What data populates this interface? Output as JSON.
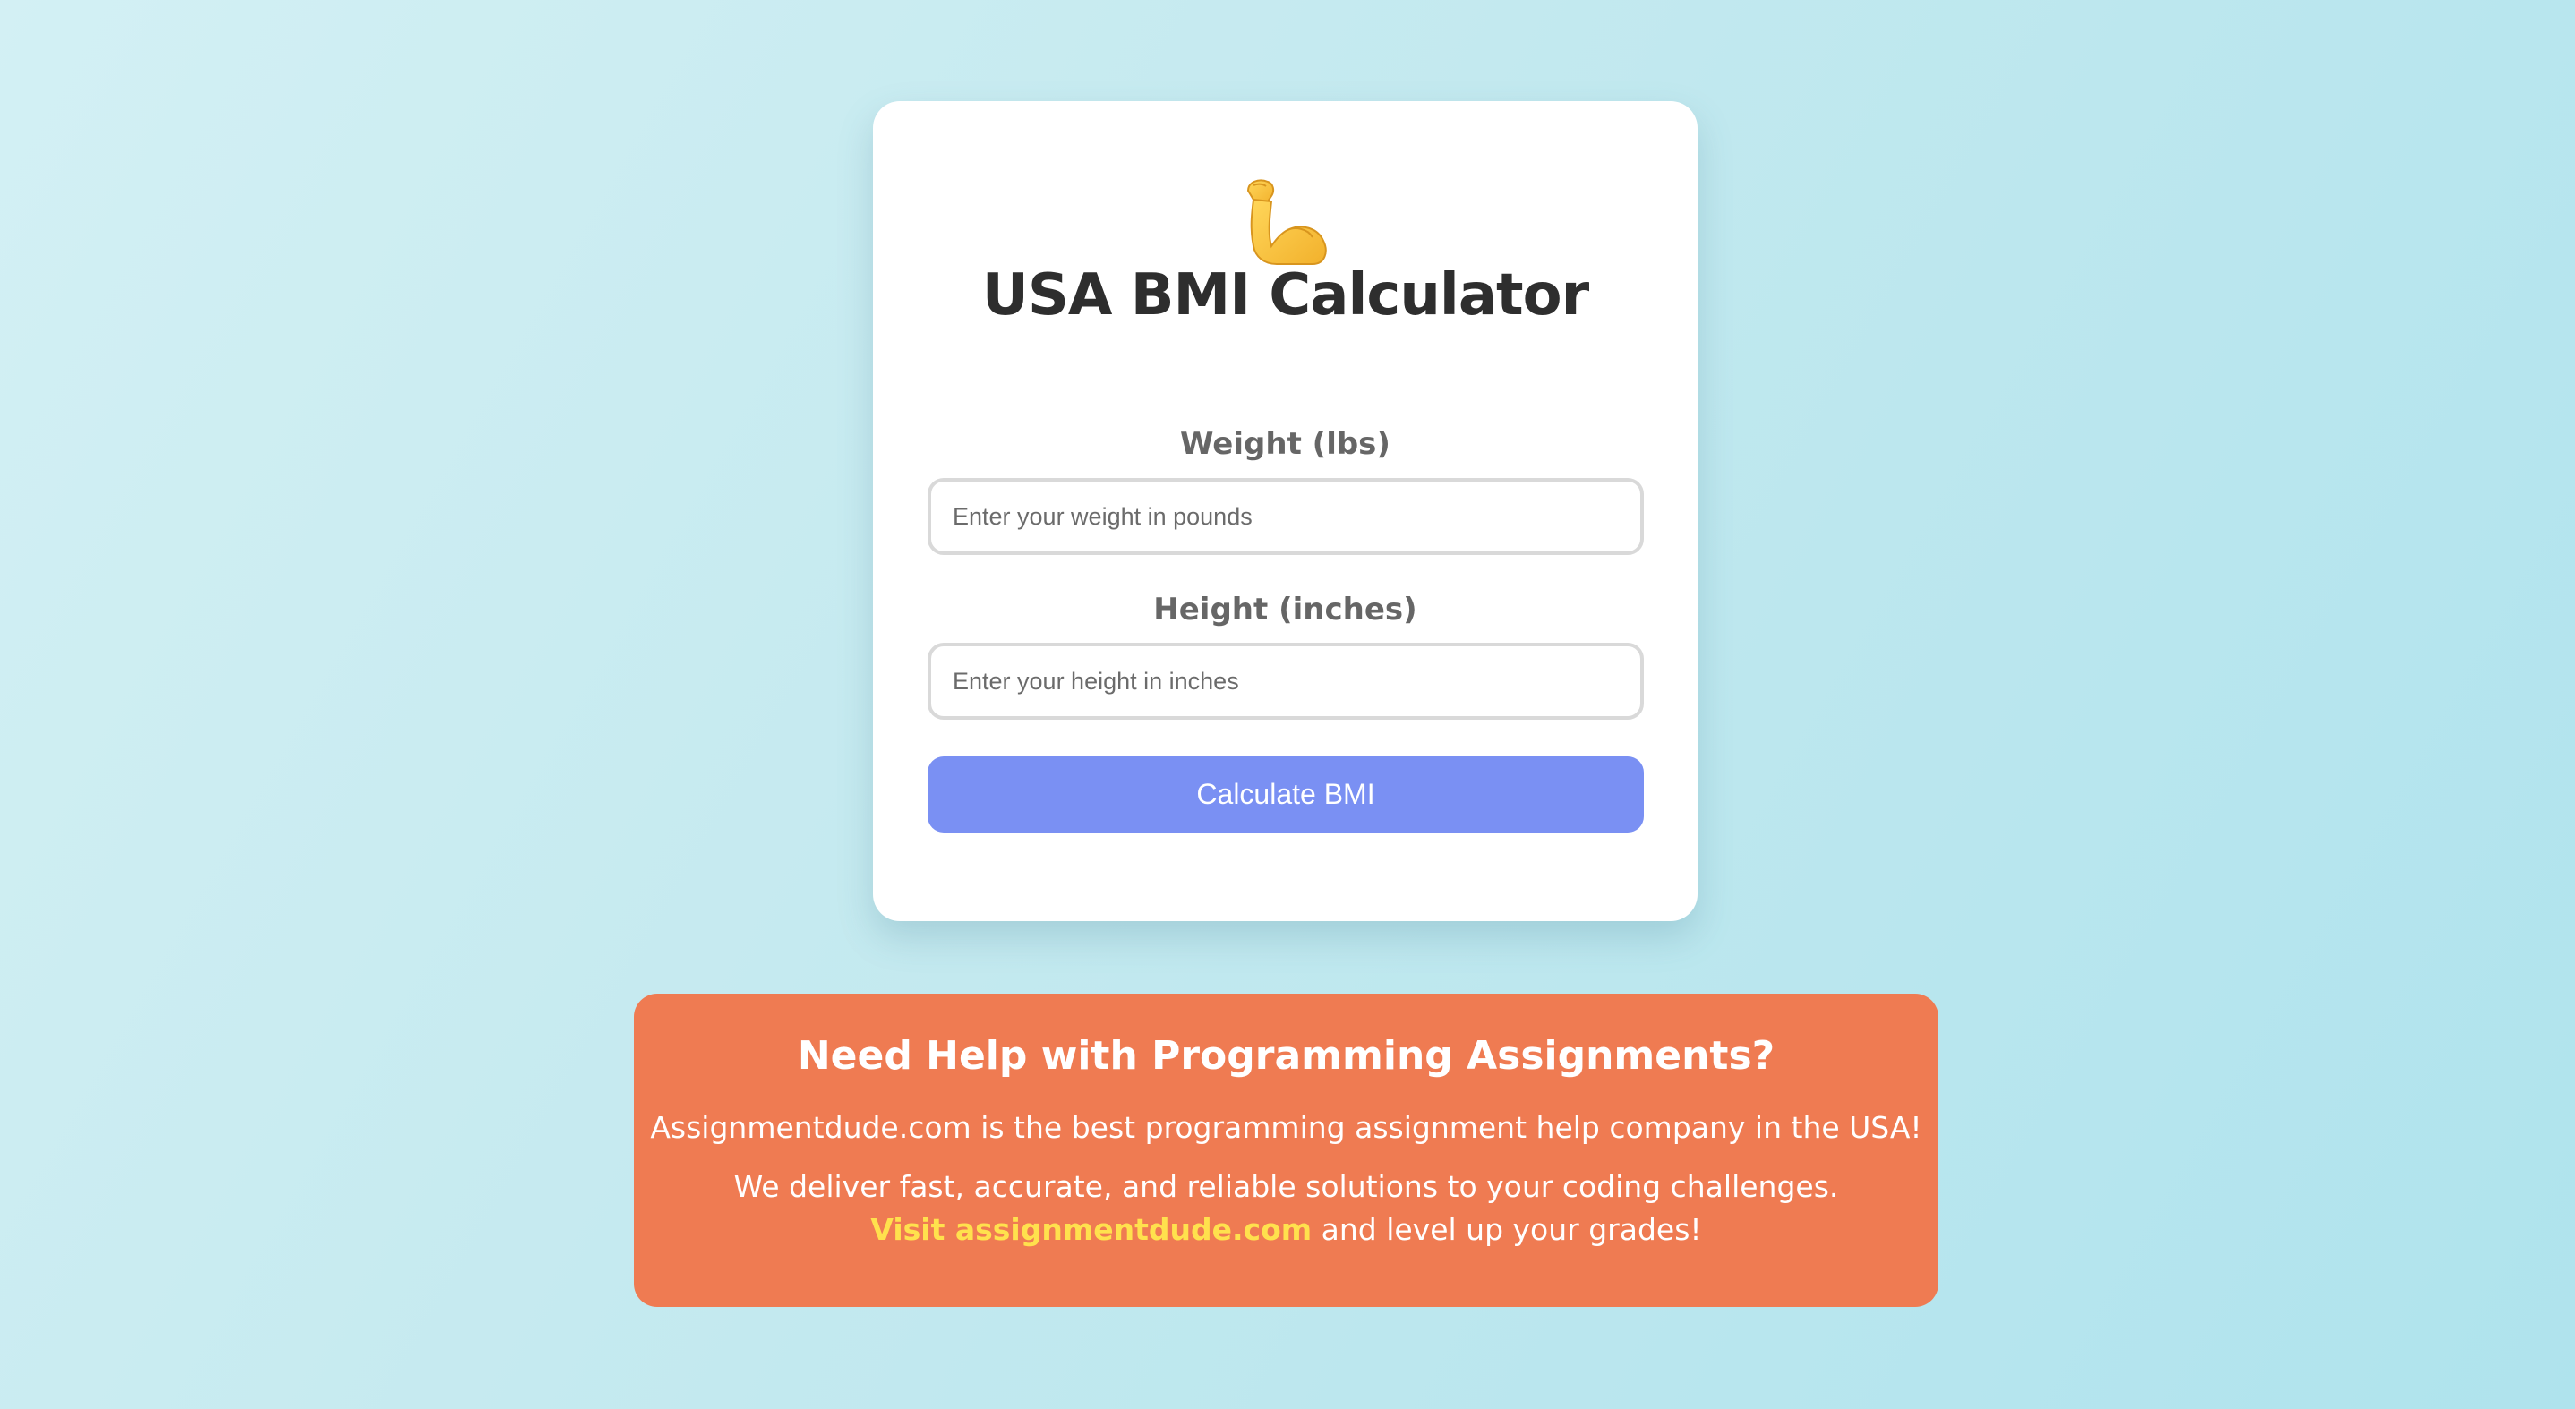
{
  "card": {
    "icon": "flexed-biceps-icon",
    "title": "USA BMI Calculator",
    "weight": {
      "label": "Weight (lbs)",
      "placeholder": "Enter your weight in pounds",
      "value": ""
    },
    "height": {
      "label": "Height (inches)",
      "placeholder": "Enter your height in inches",
      "value": ""
    },
    "button_label": "Calculate BMI"
  },
  "promo": {
    "title": "Need Help with Programming Assignments?",
    "line1": "Assignmentdude.com is the best programming assignment help company in the USA!",
    "line2": "We deliver fast, accurate, and reliable solutions to your coding challenges.",
    "link_text": "Visit assignmentdude.com",
    "line3_tail": " and level up your grades!"
  },
  "colors": {
    "background_start": "#d3f0f4",
    "background_end": "#afe3ed",
    "card": "#ffffff",
    "title_text": "#2e2e2e",
    "label_text": "#666666",
    "button": "#7a90f3",
    "promo": "#ef7b52",
    "promo_link": "#ffe14d"
  }
}
